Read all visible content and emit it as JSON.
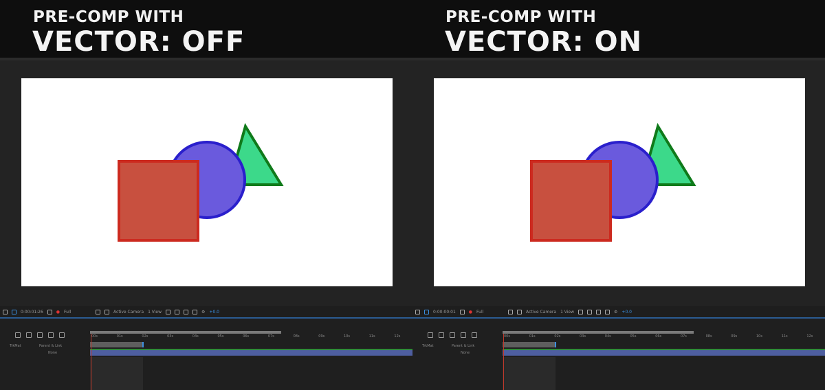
{
  "panels": [
    {
      "title_line1": "PRE-COMP WITH",
      "title_line2": "VECTOR: OFF",
      "timecode": "0:00:01:26",
      "resolution": "Full",
      "camera": "Active Camera",
      "views": "1 View",
      "exposure": "+0.0",
      "trkmat": "TrkMat",
      "parent_link": "Parent & Link",
      "parent_value": "None"
    },
    {
      "title_line1": "PRE-COMP WITH",
      "title_line2": "VECTOR: ON",
      "timecode": "0:00:00:01",
      "resolution": "Full",
      "camera": "Active Camera",
      "views": "1 View",
      "exposure": "+0.0",
      "trkmat": "TrkMat",
      "parent_link": "Parent & Link",
      "parent_value": "None"
    }
  ],
  "ruler_ticks": [
    "00s",
    "01s",
    "02s",
    "03s",
    "04s",
    "05s",
    "06s",
    "07s",
    "08s",
    "09s",
    "10s",
    "11s",
    "12s"
  ],
  "colors": {
    "square_fill": "#c8503f",
    "square_stroke": "#cc2a1f",
    "circle_fill": "#6a5add",
    "circle_stroke": "#2a1fcc",
    "triangle_fill": "#3cd98a",
    "triangle_stroke": "#0f7a1a"
  }
}
